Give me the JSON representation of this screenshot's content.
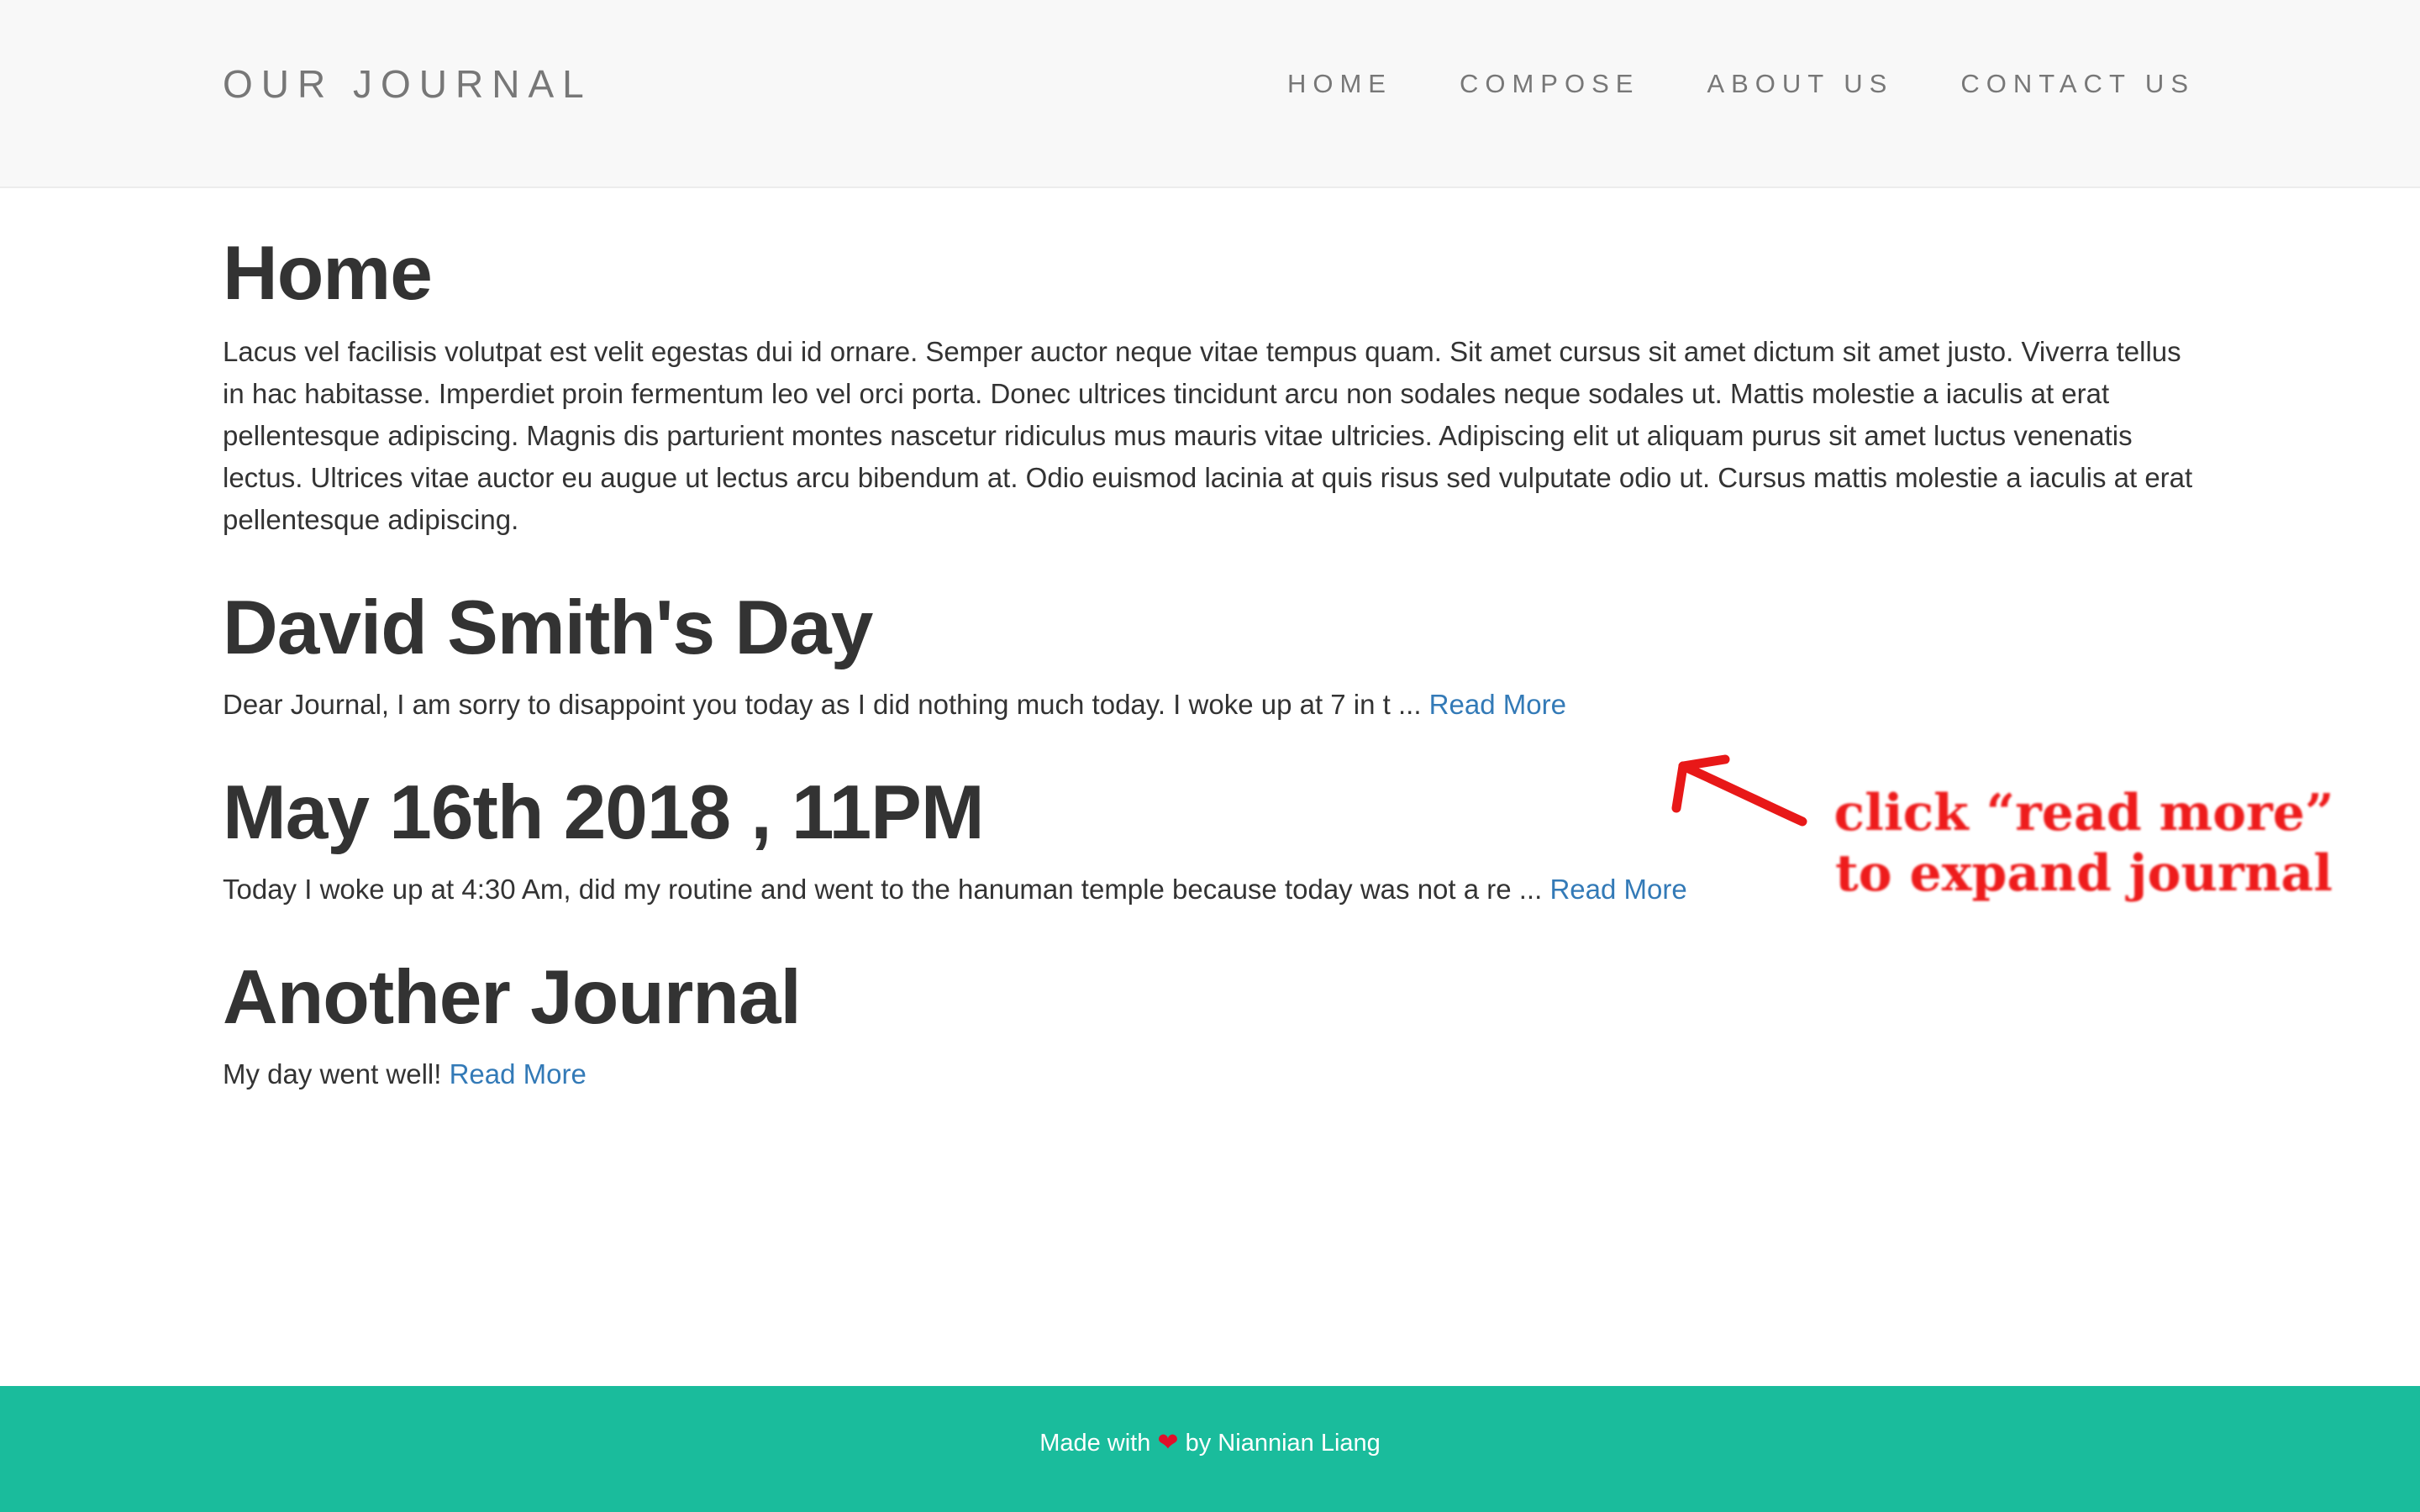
{
  "navbar": {
    "brand": "OUR JOURNAL",
    "links": [
      "HOME",
      "COMPOSE",
      "ABOUT US",
      "CONTACT US"
    ]
  },
  "home": {
    "title": "Home",
    "text": "Lacus vel facilisis volutpat est velit egestas dui id ornare. Semper auctor neque vitae tempus quam. Sit amet cursus sit amet dictum sit amet justo. Viverra tellus in hac habitasse. Imperdiet proin fermentum leo vel orci porta. Donec ultrices tincidunt arcu non sodales neque sodales ut. Mattis molestie a iaculis at erat pellentesque adipiscing. Magnis dis parturient montes nascetur ridiculus mus mauris vitae ultricies. Adipiscing elit ut aliquam purus sit amet luctus venenatis lectus. Ultrices vitae auctor eu augue ut lectus arcu bibendum at. Odio euismod lacinia at quis risus sed vulputate odio ut. Cursus mattis molestie a iaculis at erat pellentesque adipiscing."
  },
  "posts": [
    {
      "title": "David Smith's Day",
      "excerpt": "Dear Journal, I am sorry to disappoint you today as I did nothing much today. I woke up at 7 in t ... ",
      "read_more": "Read More"
    },
    {
      "title": "May 16th 2018 , 11PM",
      "excerpt": "Today I woke up at 4:30 Am, did my routine and went to the hanuman temple because today was not a re ... ",
      "read_more": "Read More"
    },
    {
      "title": "Another Journal",
      "excerpt": "My day went well! ",
      "read_more": "Read More"
    }
  ],
  "annotation": {
    "line1": "click “read more”",
    "line2": "to expand journal",
    "color": "#ee1c1c"
  },
  "footer": {
    "prefix": "Made with ",
    "heart": "❤",
    "suffix": " by Niannian Liang",
    "background": "#1abc9c"
  },
  "colors": {
    "link": "#337ab7",
    "navbar_bg": "#f8f8f8",
    "nav_text": "#777777",
    "heading": "#333333"
  }
}
